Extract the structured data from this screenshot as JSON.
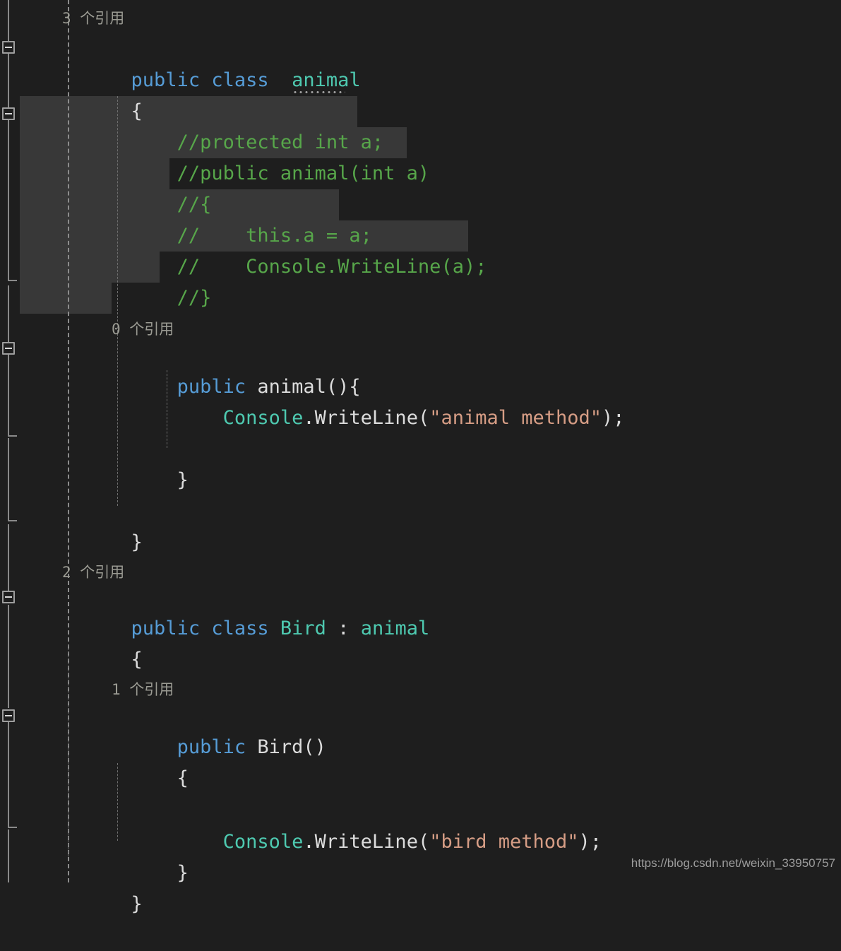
{
  "app": {
    "kind": "code-editor",
    "language": "C#",
    "theme": "dark",
    "colors": {
      "background": "#1e1e1e",
      "selection": "#383838",
      "keyword": "#569cd6",
      "type": "#4ec9b0",
      "comment": "#57a64a",
      "string": "#d69d85",
      "plain_text": "#dcdcdc",
      "codelens_text": "#9b9b93",
      "guide_line": "#8c8c8c",
      "fold_marker": "#9d9d9d",
      "watermark": "#9c9c9c"
    }
  },
  "gutter": {
    "fold_markers": [
      {
        "name": "fold-marker-animal-class",
        "state": "expanded",
        "glyph": "minus-square"
      },
      {
        "name": "fold-marker-commented-block",
        "state": "expanded",
        "glyph": "minus-square"
      },
      {
        "name": "fold-marker-animal-ctor",
        "state": "expanded",
        "glyph": "minus-square"
      },
      {
        "name": "fold-marker-bird-class",
        "state": "expanded",
        "glyph": "minus-square"
      },
      {
        "name": "fold-marker-bird-ctor",
        "state": "expanded",
        "glyph": "minus-square"
      }
    ]
  },
  "code": {
    "lines": [
      {
        "id": "codelens-animal-class",
        "type": "codelens",
        "text": "3 个引用",
        "reference_count": "3"
      },
      {
        "id": "line-animal-class-decl",
        "type": "code",
        "tokens": [
          {
            "t": "public",
            "c": "kw"
          },
          {
            "t": " class  ",
            "c": "kw"
          },
          {
            "t": "animal",
            "c": "type",
            "hint": true
          }
        ],
        "plain": "public class  animal"
      },
      {
        "id": "line-animal-open-brace",
        "type": "code",
        "tokens": [
          {
            "t": "{",
            "c": "brace"
          }
        ],
        "plain": "{"
      },
      {
        "id": "line-comment-protected-int-a",
        "type": "code",
        "selected": true,
        "tokens": [
          {
            "t": "    //protected int a;",
            "c": "cmt"
          }
        ],
        "plain": "    //protected int a;"
      },
      {
        "id": "line-comment-ctor-signature",
        "type": "code",
        "selected": true,
        "tokens": [
          {
            "t": "    //public animal(int a)",
            "c": "cmt"
          }
        ],
        "plain": "    //public animal(int a)"
      },
      {
        "id": "line-comment-open-brace",
        "type": "code",
        "selected": true,
        "tokens": [
          {
            "t": "    //{",
            "c": "cmt"
          }
        ],
        "plain": "    //{"
      },
      {
        "id": "line-comment-this-a-assign",
        "type": "code",
        "selected": true,
        "tokens": [
          {
            "t": "    //    this.a = a;",
            "c": "cmt"
          }
        ],
        "plain": "    //    this.a = a;"
      },
      {
        "id": "line-comment-writeline-a",
        "type": "code",
        "selected": true,
        "tokens": [
          {
            "t": "    //    Console.WriteLine(a);",
            "c": "cmt"
          }
        ],
        "plain": "    //    Console.WriteLine(a);"
      },
      {
        "id": "line-comment-close-brace",
        "type": "code",
        "selected": true,
        "tokens": [
          {
            "t": "    //}",
            "c": "cmt"
          }
        ],
        "plain": "    //}"
      },
      {
        "id": "line-blank-after-comments",
        "type": "code",
        "selected": true,
        "tokens": [],
        "plain": ""
      },
      {
        "id": "codelens-animal-ctor",
        "type": "codelens",
        "text": "0 个引用",
        "reference_count": "0"
      },
      {
        "id": "line-animal-ctor-decl",
        "type": "code",
        "tokens": [
          {
            "t": "    ",
            "c": "plain"
          },
          {
            "t": "public",
            "c": "kw"
          },
          {
            "t": " animal(){",
            "c": "plain"
          }
        ],
        "plain": "    public animal(){"
      },
      {
        "id": "line-animal-writeline",
        "type": "code",
        "tokens": [
          {
            "t": "        ",
            "c": "plain"
          },
          {
            "t": "Console",
            "c": "type"
          },
          {
            "t": ".WriteLine(",
            "c": "plain"
          },
          {
            "t": "\"animal method\"",
            "c": "str"
          },
          {
            "t": ");",
            "c": "plain"
          }
        ],
        "plain": "        Console.WriteLine(\"animal method\");"
      },
      {
        "id": "line-animal-ctor-close",
        "type": "code",
        "tokens": [
          {
            "t": "    }",
            "c": "brace"
          }
        ],
        "plain": "    }"
      },
      {
        "id": "line-animal-class-close",
        "type": "code",
        "tokens": [
          {
            "t": "}",
            "c": "brace"
          }
        ],
        "plain": "}"
      },
      {
        "id": "codelens-bird-class",
        "type": "codelens",
        "text": "2 个引用",
        "reference_count": "2"
      },
      {
        "id": "line-bird-class-decl",
        "type": "code",
        "tokens": [
          {
            "t": "public",
            "c": "kw"
          },
          {
            "t": " class ",
            "c": "kw"
          },
          {
            "t": "Bird",
            "c": "type"
          },
          {
            "t": " : ",
            "c": "plain"
          },
          {
            "t": "animal",
            "c": "type"
          }
        ],
        "plain": "public class Bird : animal"
      },
      {
        "id": "line-bird-open-brace",
        "type": "code",
        "tokens": [
          {
            "t": "{",
            "c": "brace"
          }
        ],
        "plain": "{"
      },
      {
        "id": "codelens-bird-ctor",
        "type": "codelens",
        "text": "1 个引用",
        "reference_count": "1"
      },
      {
        "id": "line-bird-ctor-decl",
        "type": "code",
        "tokens": [
          {
            "t": "    ",
            "c": "plain"
          },
          {
            "t": "public",
            "c": "kw"
          },
          {
            "t": " Bird()",
            "c": "plain"
          }
        ],
        "plain": "    public Bird()"
      },
      {
        "id": "line-bird-ctor-open",
        "type": "code",
        "tokens": [
          {
            "t": "    {",
            "c": "brace"
          }
        ],
        "plain": "    {"
      },
      {
        "id": "line-bird-writeline",
        "type": "code",
        "tokens": [
          {
            "t": "        ",
            "c": "plain"
          },
          {
            "t": "Console",
            "c": "type"
          },
          {
            "t": ".WriteLine(",
            "c": "plain"
          },
          {
            "t": "\"bird method\"",
            "c": "str"
          },
          {
            "t": ");",
            "c": "plain"
          }
        ],
        "plain": "        Console.WriteLine(\"bird method\");"
      },
      {
        "id": "line-bird-ctor-close",
        "type": "code",
        "tokens": [
          {
            "t": "    }",
            "c": "brace"
          }
        ],
        "plain": "    }"
      },
      {
        "id": "line-bird-class-close",
        "type": "code",
        "tokens": [
          {
            "t": "}",
            "c": "brace"
          }
        ],
        "plain": "}"
      }
    ]
  },
  "watermark": {
    "text": "https://blog.csdn.net/weixin_33950757"
  }
}
